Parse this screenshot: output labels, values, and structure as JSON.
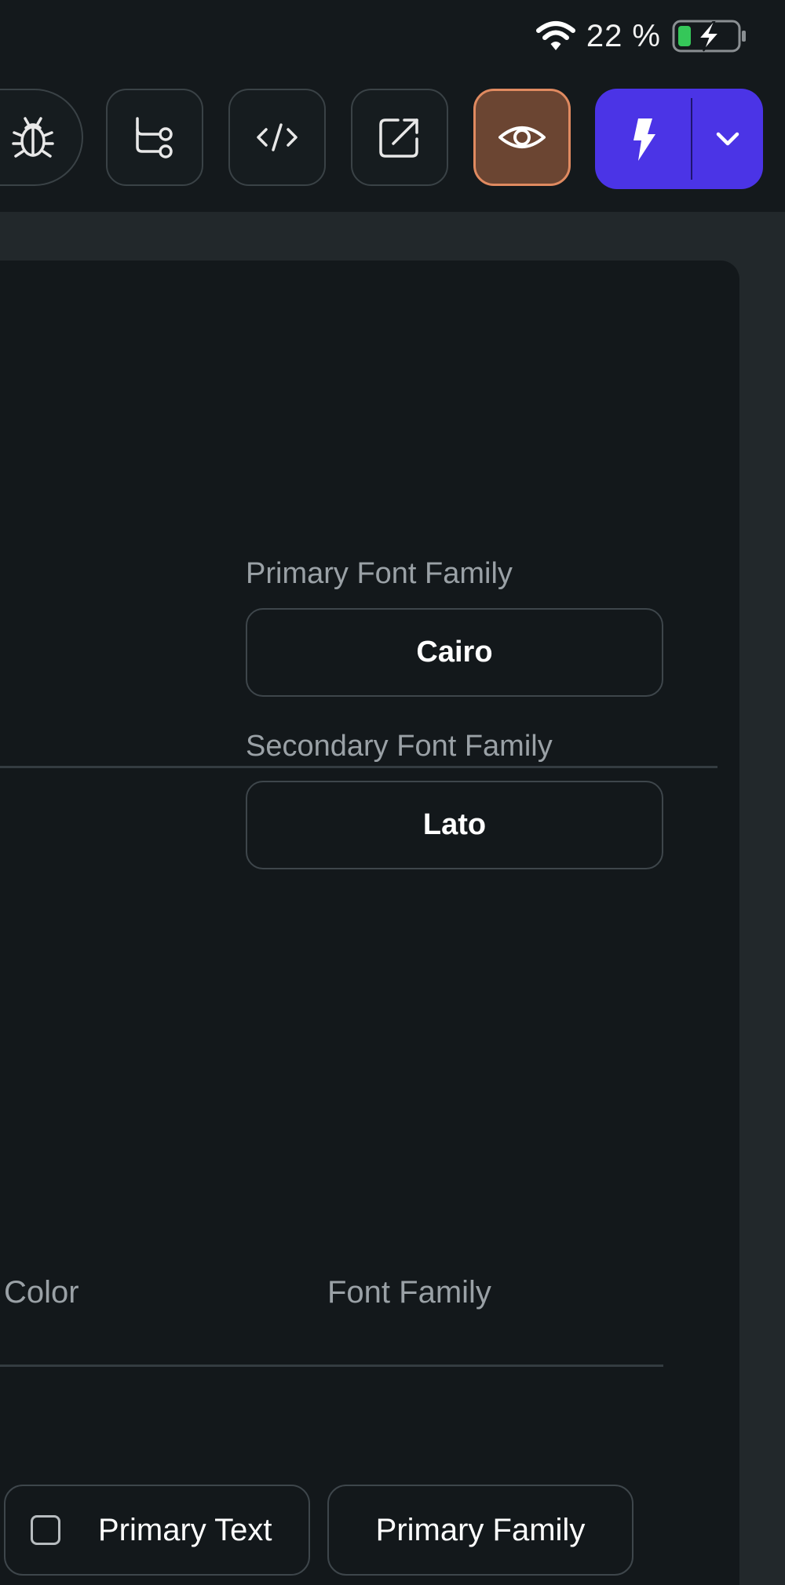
{
  "status_bar": {
    "battery_percent": "22 %",
    "icons": [
      "wifi-icon",
      "battery-charging-icon"
    ]
  },
  "toolbar": {
    "buttons": [
      {
        "icon": "bug-icon"
      },
      {
        "icon": "branch-tree-icon"
      },
      {
        "icon": "code-icon"
      },
      {
        "icon": "open-external-icon"
      },
      {
        "icon": "eye-icon",
        "active": true
      },
      {
        "icon": "lightning-icon",
        "dropdown_icon": "chevron-down-icon"
      }
    ],
    "colors": {
      "preview_bg": "#6b4532",
      "preview_border": "#e08a60",
      "run_bg": "#4b34e6"
    }
  },
  "typography": {
    "primary_font_label": "Primary Font Family",
    "primary_font_value": "Cairo",
    "secondary_font_label": "Secondary Font Family",
    "secondary_font_value": "Lato"
  },
  "table": {
    "columns": [
      "Color",
      "Font Family"
    ],
    "rows": [
      {
        "color": "Primary Text",
        "color_checked": false,
        "font_family": "Primary Family"
      }
    ]
  }
}
